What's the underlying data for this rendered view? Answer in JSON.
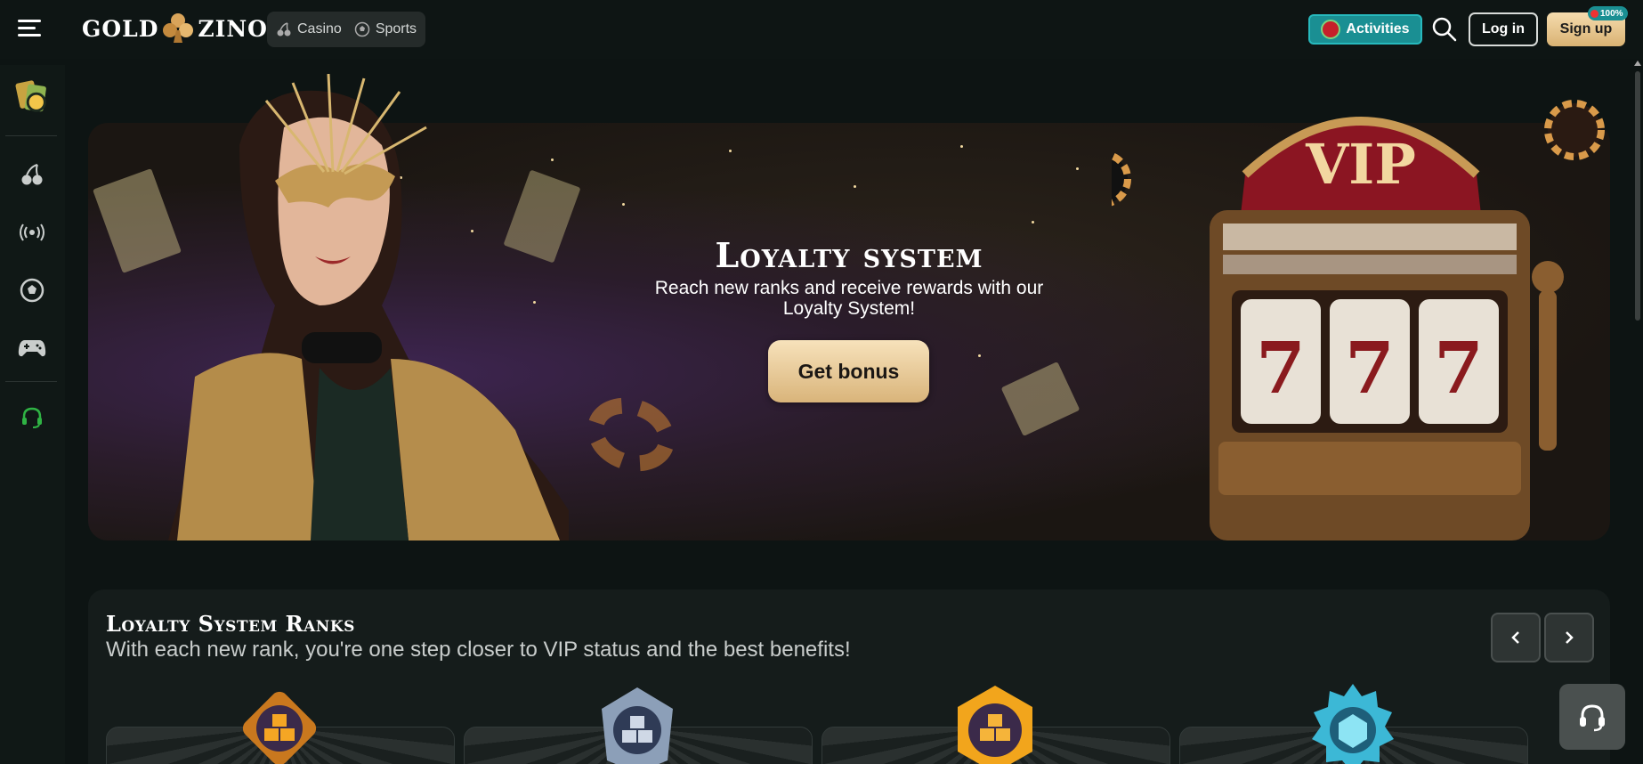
{
  "header": {
    "logo_left": "GOLD",
    "logo_right": "ZINO",
    "nav": [
      {
        "label": "Casino",
        "icon": "cherry-icon"
      },
      {
        "label": "Sports",
        "icon": "soccer-ball-icon"
      }
    ],
    "activities_label": "Activities",
    "login_label": "Log in",
    "signup_label": "Sign up",
    "signup_badge": "100%"
  },
  "sidebar": {
    "items": [
      {
        "name": "promotions",
        "icon": "bonus-cards-icon"
      },
      {
        "name": "casino",
        "icon": "cherry-icon"
      },
      {
        "name": "live",
        "icon": "live-broadcast-icon"
      },
      {
        "name": "sports",
        "icon": "soccer-ball-icon"
      },
      {
        "name": "esports",
        "icon": "gamepad-icon"
      },
      {
        "name": "support",
        "icon": "headset-icon"
      }
    ]
  },
  "hero": {
    "title": "Loyalty system",
    "subtitle": "Reach new ranks and receive rewards with our Loyalty System!",
    "cta": "Get bonus",
    "slot_text": "VIP",
    "slot_reels": [
      "7",
      "7",
      "7"
    ]
  },
  "ranks": {
    "title": "Loyalty System Ranks",
    "subtitle": "With each new rank, you're one step closer to VIP status and the best benefits!",
    "badges": [
      "bronze-rank-icon",
      "silver-rank-icon",
      "gold-rank-icon",
      "diamond-rank-icon"
    ]
  },
  "colors": {
    "accent_gold": "#d9b273",
    "accent_teal": "#1a8f93",
    "background": "#0d1413"
  }
}
